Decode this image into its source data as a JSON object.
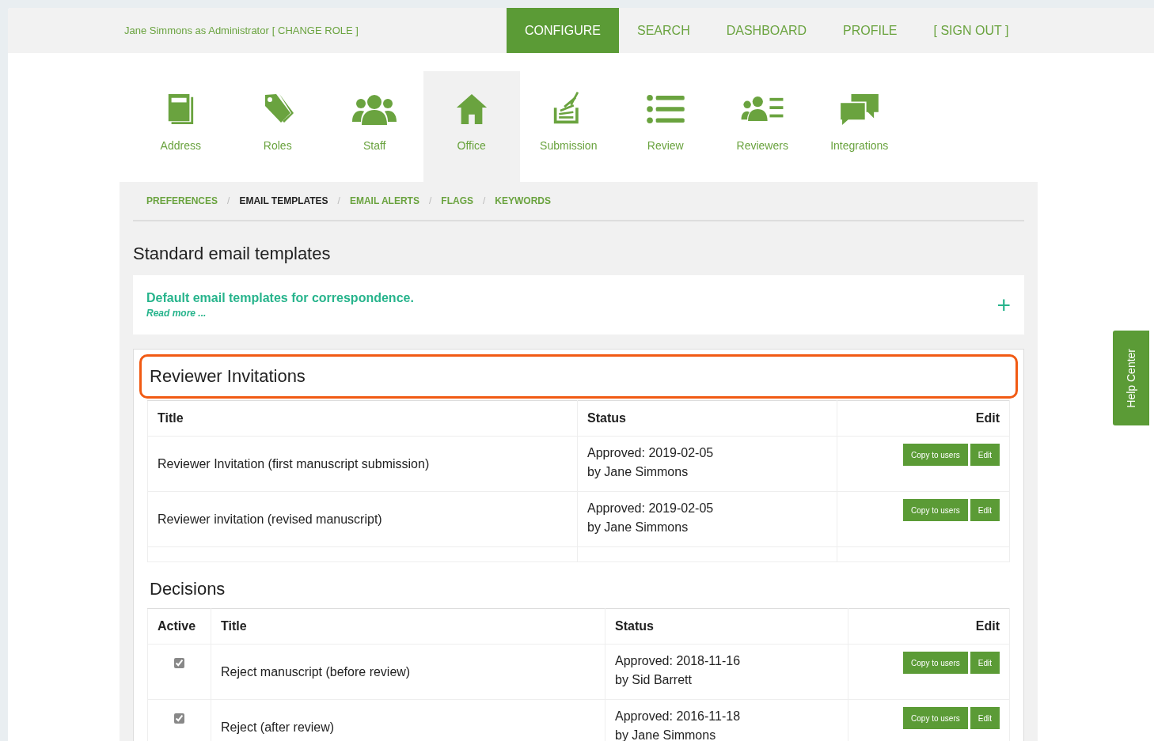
{
  "user": {
    "name": "Jane Simmons as Administrator",
    "change_role": "[ CHANGE ROLE ]"
  },
  "main_nav": [
    {
      "label": "CONFIGURE",
      "selected": true
    },
    {
      "label": "SEARCH",
      "selected": false
    },
    {
      "label": "DASHBOARD",
      "selected": false
    },
    {
      "label": "PROFILE",
      "selected": false
    },
    {
      "label": "[ SIGN OUT ]",
      "selected": false
    }
  ],
  "config_nav": [
    {
      "label": "Address",
      "selected": false
    },
    {
      "label": "Roles",
      "selected": false
    },
    {
      "label": "Staff",
      "selected": false
    },
    {
      "label": "Office",
      "selected": true
    },
    {
      "label": "Submission",
      "selected": false
    },
    {
      "label": "Review",
      "selected": false
    },
    {
      "label": "Reviewers",
      "selected": false
    },
    {
      "label": "Integrations",
      "selected": false
    }
  ],
  "sub_nav": [
    {
      "label": "PREFERENCES",
      "selected": false
    },
    {
      "separator": "/",
      "label": "EMAIL TEMPLATES",
      "selected": true
    },
    {
      "separator": "/",
      "label": "EMAIL ALERTS",
      "selected": false
    },
    {
      "separator": "/",
      "label": "FLAGS",
      "selected": false
    },
    {
      "separator": "/",
      "label": "KEYWORDS",
      "selected": false
    }
  ],
  "page_title": "Standard email templates",
  "info": {
    "title": "Default email templates for correspondence.",
    "read_more": "Read more ...",
    "expand": "+"
  },
  "sections": [
    {
      "title": "Reviewer Invitations",
      "highlighted": true,
      "columns": [
        "Title",
        "Status",
        "Edit"
      ],
      "trailing_empty_row": true,
      "rows": [
        {
          "title": "Reviewer Invitation (first manuscript submission)",
          "status": "Approved: 2019-02-05",
          "by": "by Jane Simmons",
          "copy": "Copy to users",
          "edit": "Edit"
        },
        {
          "title": "Reviewer invitation (revised manuscript)",
          "status": "Approved: 2019-02-05",
          "by": "by Jane Simmons",
          "copy": "Copy to users",
          "edit": "Edit"
        }
      ]
    },
    {
      "title": "Decisions",
      "highlighted": false,
      "columns": [
        "Active",
        "Title",
        "Status",
        "Edit"
      ],
      "trailing_empty_row": false,
      "rows": [
        {
          "active": true,
          "title": "Reject manuscript (before review)",
          "status": "Approved: 2018-11-16",
          "by": "by Sid Barrett",
          "copy": "Copy to users",
          "edit": "Edit"
        },
        {
          "active": true,
          "title": "Reject (after review)",
          "status": "Approved: 2016-11-18",
          "by": "by Jane Simmons",
          "copy": "Copy to users",
          "edit": "Edit"
        }
      ]
    }
  ],
  "help_tab": "Help Center"
}
